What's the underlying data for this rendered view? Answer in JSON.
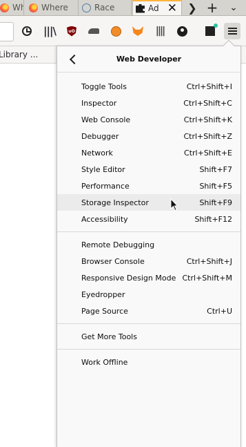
{
  "tabs": [
    {
      "label": "Where",
      "icon": "firefox-icon"
    },
    {
      "label": "Where",
      "icon": "firefox-icon"
    },
    {
      "label": "Race",
      "icon": "globe-icon"
    },
    {
      "label": "Ad",
      "icon": "puzzle-icon",
      "active": true
    }
  ],
  "tabstrip": {
    "close": "✕",
    "scroll": "❯",
    "new_tab": "+",
    "all_tabs": "⌄"
  },
  "bookmarks": {
    "library": "Library ..."
  },
  "panel": {
    "title": "Web Developer",
    "items": [
      {
        "label": "Toggle Tools",
        "shortcut": "Ctrl+Shift+I"
      },
      {
        "label": "Inspector",
        "shortcut": "Ctrl+Shift+C"
      },
      {
        "label": "Web Console",
        "shortcut": "Ctrl+Shift+K"
      },
      {
        "label": "Debugger",
        "shortcut": "Ctrl+Shift+Z"
      },
      {
        "label": "Network",
        "shortcut": "Ctrl+Shift+E"
      },
      {
        "label": "Style Editor",
        "shortcut": "Shift+F7"
      },
      {
        "label": "Performance",
        "shortcut": "Shift+F5"
      },
      {
        "label": "Storage Inspector",
        "shortcut": "Shift+F9"
      },
      {
        "label": "Accessibility",
        "shortcut": "Shift+F12"
      },
      {
        "label": "Remote Debugging",
        "shortcut": ""
      },
      {
        "label": "Browser Console",
        "shortcut": "Ctrl+Shift+J"
      },
      {
        "label": "Responsive Design Mode",
        "shortcut": "Ctrl+Shift+M"
      },
      {
        "label": "Eyedropper",
        "shortcut": ""
      },
      {
        "label": "Page Source",
        "shortcut": "Ctrl+U"
      },
      {
        "label": "Get More Tools",
        "shortcut": ""
      },
      {
        "label": "Work Offline",
        "shortcut": ""
      }
    ],
    "hovered_item": "Storage Inspector"
  }
}
